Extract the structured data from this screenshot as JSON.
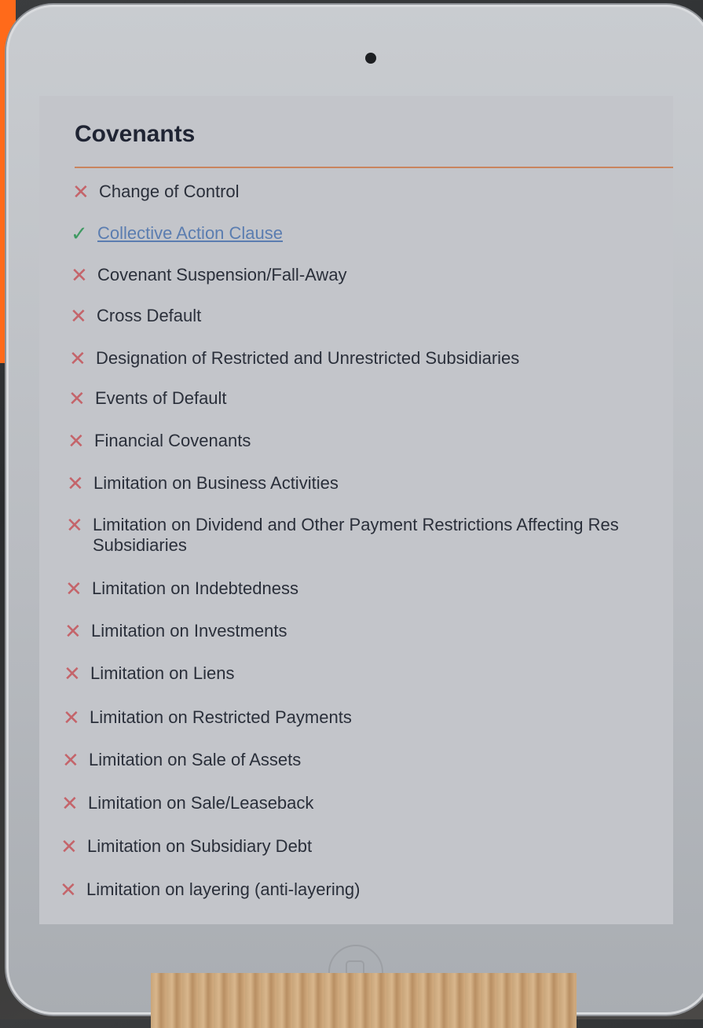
{
  "screen": {
    "title": "Covenants",
    "items": [
      {
        "label": "Change of Control",
        "status": "x-icon"
      },
      {
        "label": "Collective Action Clause",
        "status": "check-icon",
        "link": true
      },
      {
        "label": "Covenant Suspension/Fall-Away",
        "status": "x-icon"
      },
      {
        "label": "Cross Default",
        "status": "x-icon"
      },
      {
        "label": "Designation of Restricted and Unrestricted Subsidiaries",
        "status": "x-icon"
      },
      {
        "label": "Events of Default",
        "status": "x-icon"
      },
      {
        "label": "Financial Covenants",
        "status": "x-icon"
      },
      {
        "label": "Limitation on Business Activities",
        "status": "x-icon"
      },
      {
        "label": "Limitation on Dividend and Other Payment Restrictions Affecting Res",
        "label_line2": "Subsidiaries",
        "status": "x-icon"
      },
      {
        "label": "Limitation on Indebtedness",
        "status": "x-icon"
      },
      {
        "label": "Limitation on Investments",
        "status": "x-icon"
      },
      {
        "label": "Limitation on Liens",
        "status": "x-icon"
      },
      {
        "label": "Limitation on Restricted Payments",
        "status": "x-icon"
      },
      {
        "label": "Limitation on Sale of Assets",
        "status": "x-icon"
      },
      {
        "label": "Limitation on Sale/Leaseback",
        "status": "x-icon"
      },
      {
        "label": "Limitation on Subsidiary Debt",
        "status": "x-icon"
      },
      {
        "label": "Limitation on layering (anti-layering)",
        "status": "x-icon"
      }
    ]
  },
  "colors": {
    "accent": "#ff6a1a",
    "check": "#3f9a62",
    "cross": "#c4646a",
    "link": "#5b7db0",
    "rule": "#c9845e"
  }
}
